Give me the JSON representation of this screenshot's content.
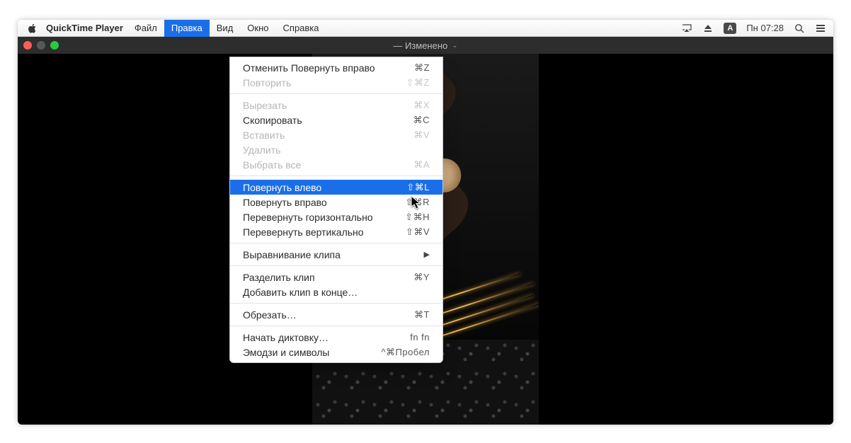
{
  "menubar": {
    "app_name": "QuickTime Player",
    "items": [
      "Файл",
      "Правка",
      "Вид",
      "Окно",
      "Справка"
    ],
    "active_index": 1,
    "right": {
      "lang": "А",
      "clock": "Пн 07:28"
    }
  },
  "window": {
    "title": "— Изменено"
  },
  "dropdown": {
    "groups": [
      [
        {
          "label": "Отменить Повернуть вправо",
          "shortcut": "⌘Z",
          "disabled": false
        },
        {
          "label": "Повторить",
          "shortcut": "⇧⌘Z",
          "disabled": true
        }
      ],
      [
        {
          "label": "Вырезать",
          "shortcut": "⌘X",
          "disabled": true
        },
        {
          "label": "Скопировать",
          "shortcut": "⌘C",
          "disabled": false
        },
        {
          "label": "Вставить",
          "shortcut": "⌘V",
          "disabled": true
        },
        {
          "label": "Удалить",
          "shortcut": "",
          "disabled": true
        },
        {
          "label": "Выбрать все",
          "shortcut": "⌘A",
          "disabled": true
        }
      ],
      [
        {
          "label": "Повернуть влево",
          "shortcut": "⇧⌘L",
          "disabled": false,
          "highlight": true
        },
        {
          "label": "Повернуть вправо",
          "shortcut": "⇧⌘R",
          "disabled": false
        },
        {
          "label": "Перевернуть горизонтально",
          "shortcut": "⇧⌘H",
          "disabled": false
        },
        {
          "label": "Перевернуть вертикально",
          "shortcut": "⇧⌘V",
          "disabled": false
        }
      ],
      [
        {
          "label": "Выравнивание клипа",
          "shortcut": "",
          "disabled": false,
          "submenu": true
        }
      ],
      [
        {
          "label": "Разделить клип",
          "shortcut": "⌘Y",
          "disabled": false
        },
        {
          "label": "Добавить клип в конце…",
          "shortcut": "",
          "disabled": false
        }
      ],
      [
        {
          "label": "Обрезать…",
          "shortcut": "⌘T",
          "disabled": false
        }
      ],
      [
        {
          "label": "Начать диктовку…",
          "shortcut": "fn fn",
          "disabled": false
        },
        {
          "label": "Эмодзи и символы",
          "shortcut": "^⌘Пробел",
          "disabled": false
        }
      ]
    ]
  }
}
